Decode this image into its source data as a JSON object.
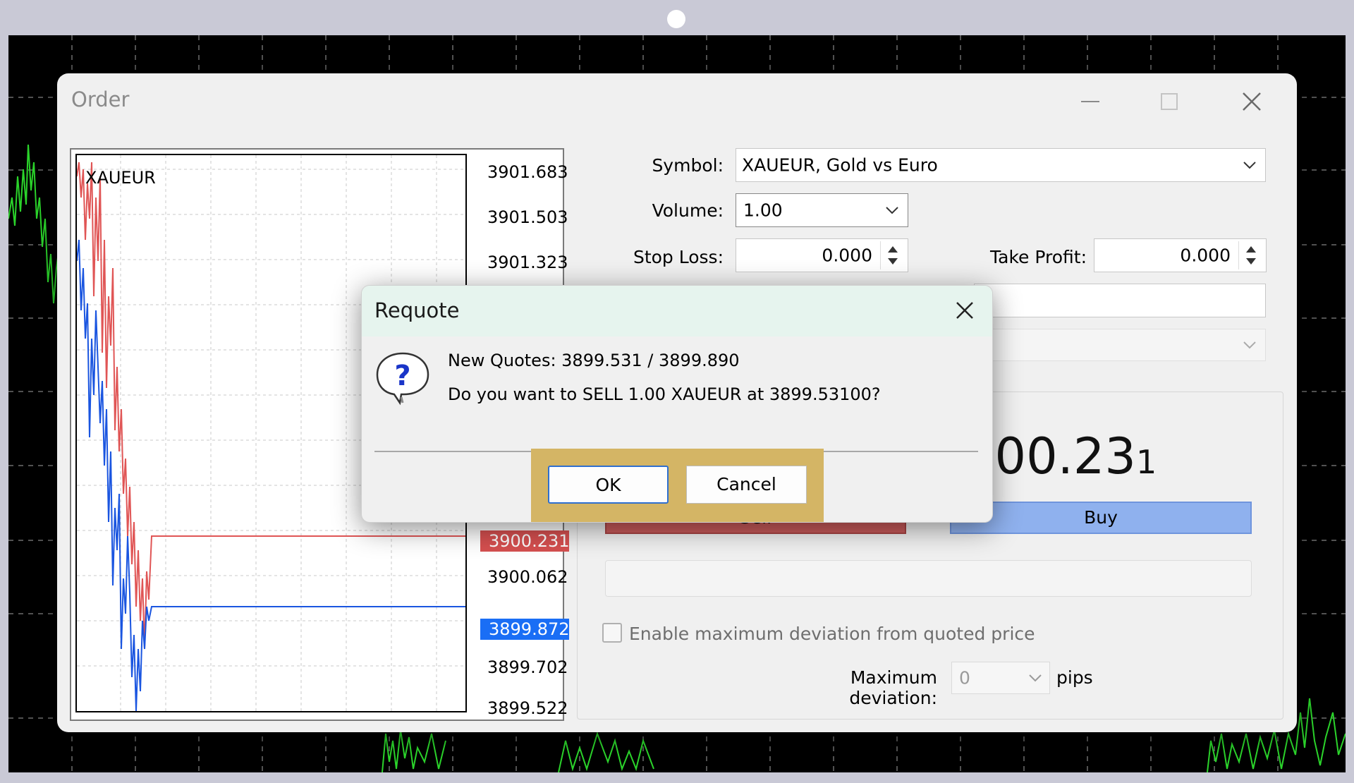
{
  "order_window": {
    "title": "Order",
    "symbol_label": "Symbol:",
    "symbol_value": "XAUEUR, Gold vs Euro",
    "volume_label": "Volume:",
    "volume_value": "1.00",
    "stop_loss_label": "Stop Loss:",
    "stop_loss_value": "0.000",
    "take_profit_label": "Take Profit:",
    "take_profit_value": "0.000",
    "big_price": "900.23",
    "big_price_last_digit": "1",
    "sell_label": "Sell",
    "buy_label": "Buy",
    "deviation_checkbox_label": "Enable maximum deviation from quoted price",
    "max_deviation_label": "Maximum deviation:",
    "max_deviation_value": "0",
    "max_deviation_unit": "pips"
  },
  "mini_chart": {
    "symbol": "XAUEUR",
    "ticks": [
      "3901.683",
      "3901.503",
      "3901.323",
      "3900.062",
      "3899.702",
      "3899.522"
    ],
    "partial_tick": "3900.242",
    "bid_tag": "3900.231",
    "ask_tag": "3899.872",
    "colors": {
      "bid": "#e05555",
      "ask": "#1a55e0"
    }
  },
  "requote_dialog": {
    "title": "Requote",
    "new_quotes": "New Quotes: 3899.531 / 3899.890",
    "question": "Do you want to SELL 1.00 XAUEUR at 3899.53100?",
    "ok_label": "OK",
    "cancel_label": "Cancel",
    "highlight_color": "#d4b565"
  }
}
